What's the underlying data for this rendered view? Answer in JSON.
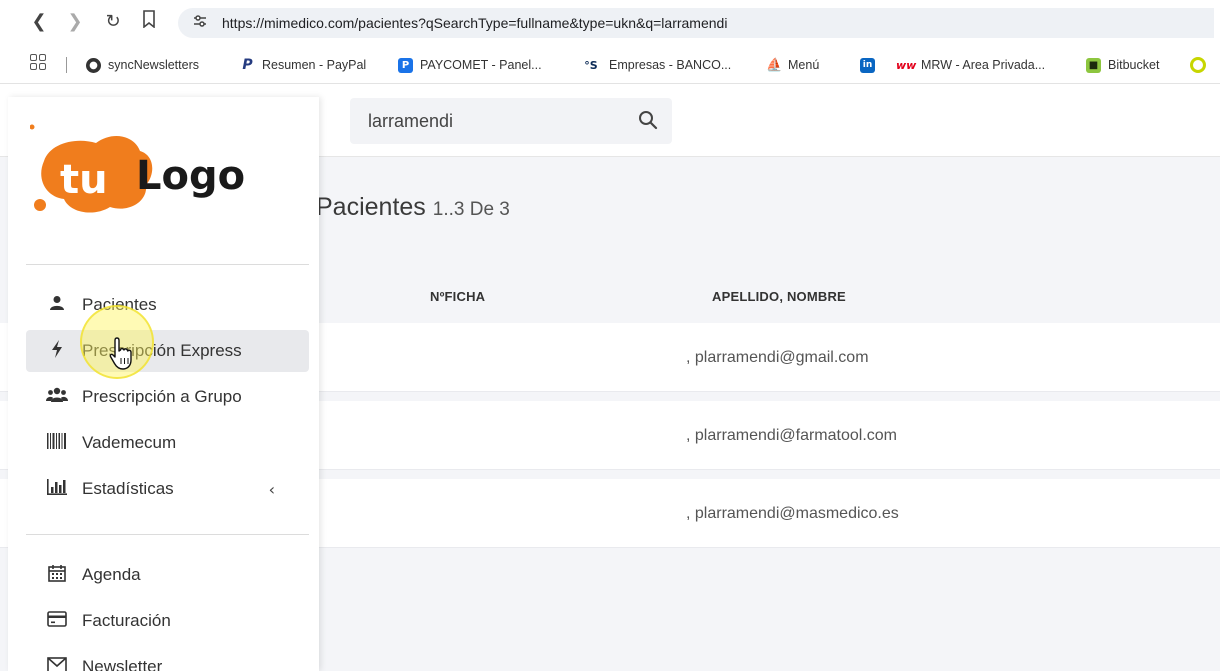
{
  "browser": {
    "url": "https://mimedico.com/pacientes?qSearchType=fullname&type=ukn&q=larramendi",
    "bookmarks": [
      {
        "label": "syncNewsletters",
        "icon": "globe-icon",
        "color": "#333333"
      },
      {
        "label": "Resumen - PayPal",
        "icon": "paypal-icon",
        "color": "#253b80"
      },
      {
        "label": "PAYCOMET - Panel...",
        "icon": "paycomet-icon",
        "color": "#1a73e8"
      },
      {
        "label": "Empresas - BANCO...",
        "icon": "banco-icon",
        "color": "#0b2a56"
      },
      {
        "label": "Menú",
        "icon": "boat-icon",
        "color": "#2a7ab8"
      },
      {
        "label": "",
        "icon": "linkedin-icon",
        "color": "#0a66c2"
      },
      {
        "label": "MRW - Area Privada...",
        "icon": "mrw-icon",
        "color": "#e2001a"
      },
      {
        "label": "Bitbucket",
        "icon": "bitbucket-icon",
        "color": "#8dc63f"
      }
    ]
  },
  "search": {
    "value": "larramendi",
    "placeholder": ""
  },
  "page": {
    "title": "Pacientes",
    "count": "1..3 De 3"
  },
  "table": {
    "headers": [
      "NºFICHA",
      "APELLIDO, NOMBRE"
    ],
    "rows": [
      {
        "ficha": "",
        "nombre": ", plarramendi@gmail.com"
      },
      {
        "ficha": "",
        "nombre": ", plarramendi@farmatool.com"
      },
      {
        "ficha": "",
        "nombre": ", plarramendi@masmedico.es"
      }
    ]
  },
  "sidebar": {
    "logo_text": "tulogo",
    "menu": [
      {
        "label": "Pacientes",
        "icon": "user-icon"
      },
      {
        "label": "Prescripción Express",
        "icon": "bolt-icon",
        "active": true
      },
      {
        "label": "Prescripción a Grupo",
        "icon": "users-icon"
      },
      {
        "label": "Vademecum",
        "icon": "barcode-icon"
      },
      {
        "label": "Estadísticas",
        "icon": "bar-chart-icon",
        "caret": "‹"
      }
    ],
    "menu2": [
      {
        "label": "Agenda",
        "icon": "calendar-icon"
      },
      {
        "label": "Facturación",
        "icon": "credit-card-icon"
      },
      {
        "label": "Newsletter",
        "icon": "envelope-icon"
      }
    ]
  },
  "colors": {
    "logo_orange": "#f07d1d",
    "active_bg": "#e8e9ec",
    "page_bg": "#f4f5f8"
  }
}
